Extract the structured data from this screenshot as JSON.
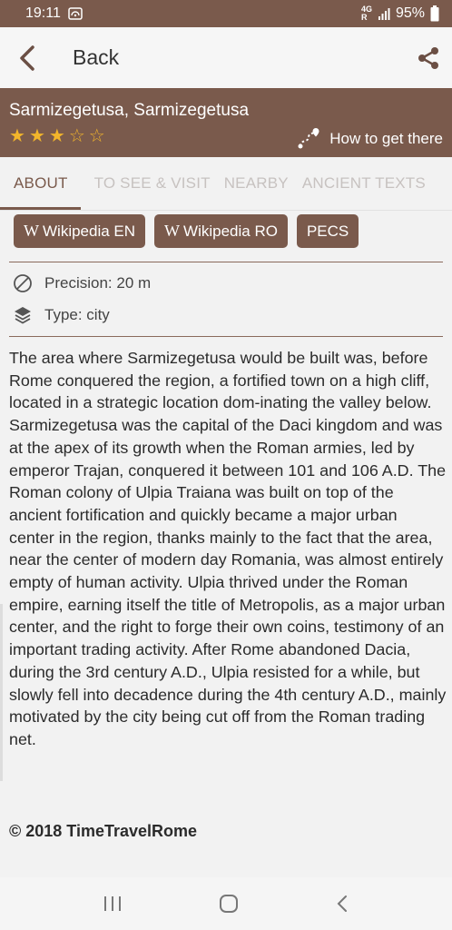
{
  "status": {
    "time": "19:11",
    "network_top": "4G",
    "network_bottom": "R",
    "battery": "95%"
  },
  "app_bar": {
    "back_label": "Back"
  },
  "place": {
    "title": "Sarmizegetusa, Sarmizegetusa",
    "rating": 3,
    "rating_max": 5,
    "how_to_get": "How to get there"
  },
  "tabs": [
    "ABOUT",
    "TO SEE & VISIT",
    "NEARBY",
    "ANCIENT TEXTS"
  ],
  "links": {
    "wiki_en": "Wikipedia EN",
    "wiki_ro": "Wikipedia RO",
    "pecs": "PECS",
    "wiki_glyph": "W"
  },
  "meta": {
    "precision": "Precision: 20 m",
    "type": "Type: city"
  },
  "description": "The area where Sarmizegetusa would be built was, before Rome conquered the region, a fortified town on a high cliff, located in a strategic location dom-inating the valley below. Sarmizegetusa was the capital of the Daci kingdom and was at the apex of its growth when the Roman armies, led by emperor Trajan, conquered it between 101 and 106 A.D. The Roman colony of Ulpia Traiana was built on top of the ancient fortification and quickly became a major urban center in the region, thanks mainly to the fact that the area, near the center of modern day Romania, was almost entirely empty of human activity. Ulpia thrived under the Roman empire, earning itself the title of Metropolis, as a major urban center, and the right to forge their own coins, testimony of an important trading activity. After Rome abandoned Dacia, during the 3rd century A.D., Ulpia resisted for a while, but slowly fell into decadence during the 4th century A.D., mainly motivated by the city being cut off from the Roman trading net.",
  "copyright": "© 2018 TimeTravelRome",
  "colors": {
    "brand": "#7a5a4c",
    "star": "#f2b52b",
    "tab_inactive": "#c7c2c0"
  }
}
